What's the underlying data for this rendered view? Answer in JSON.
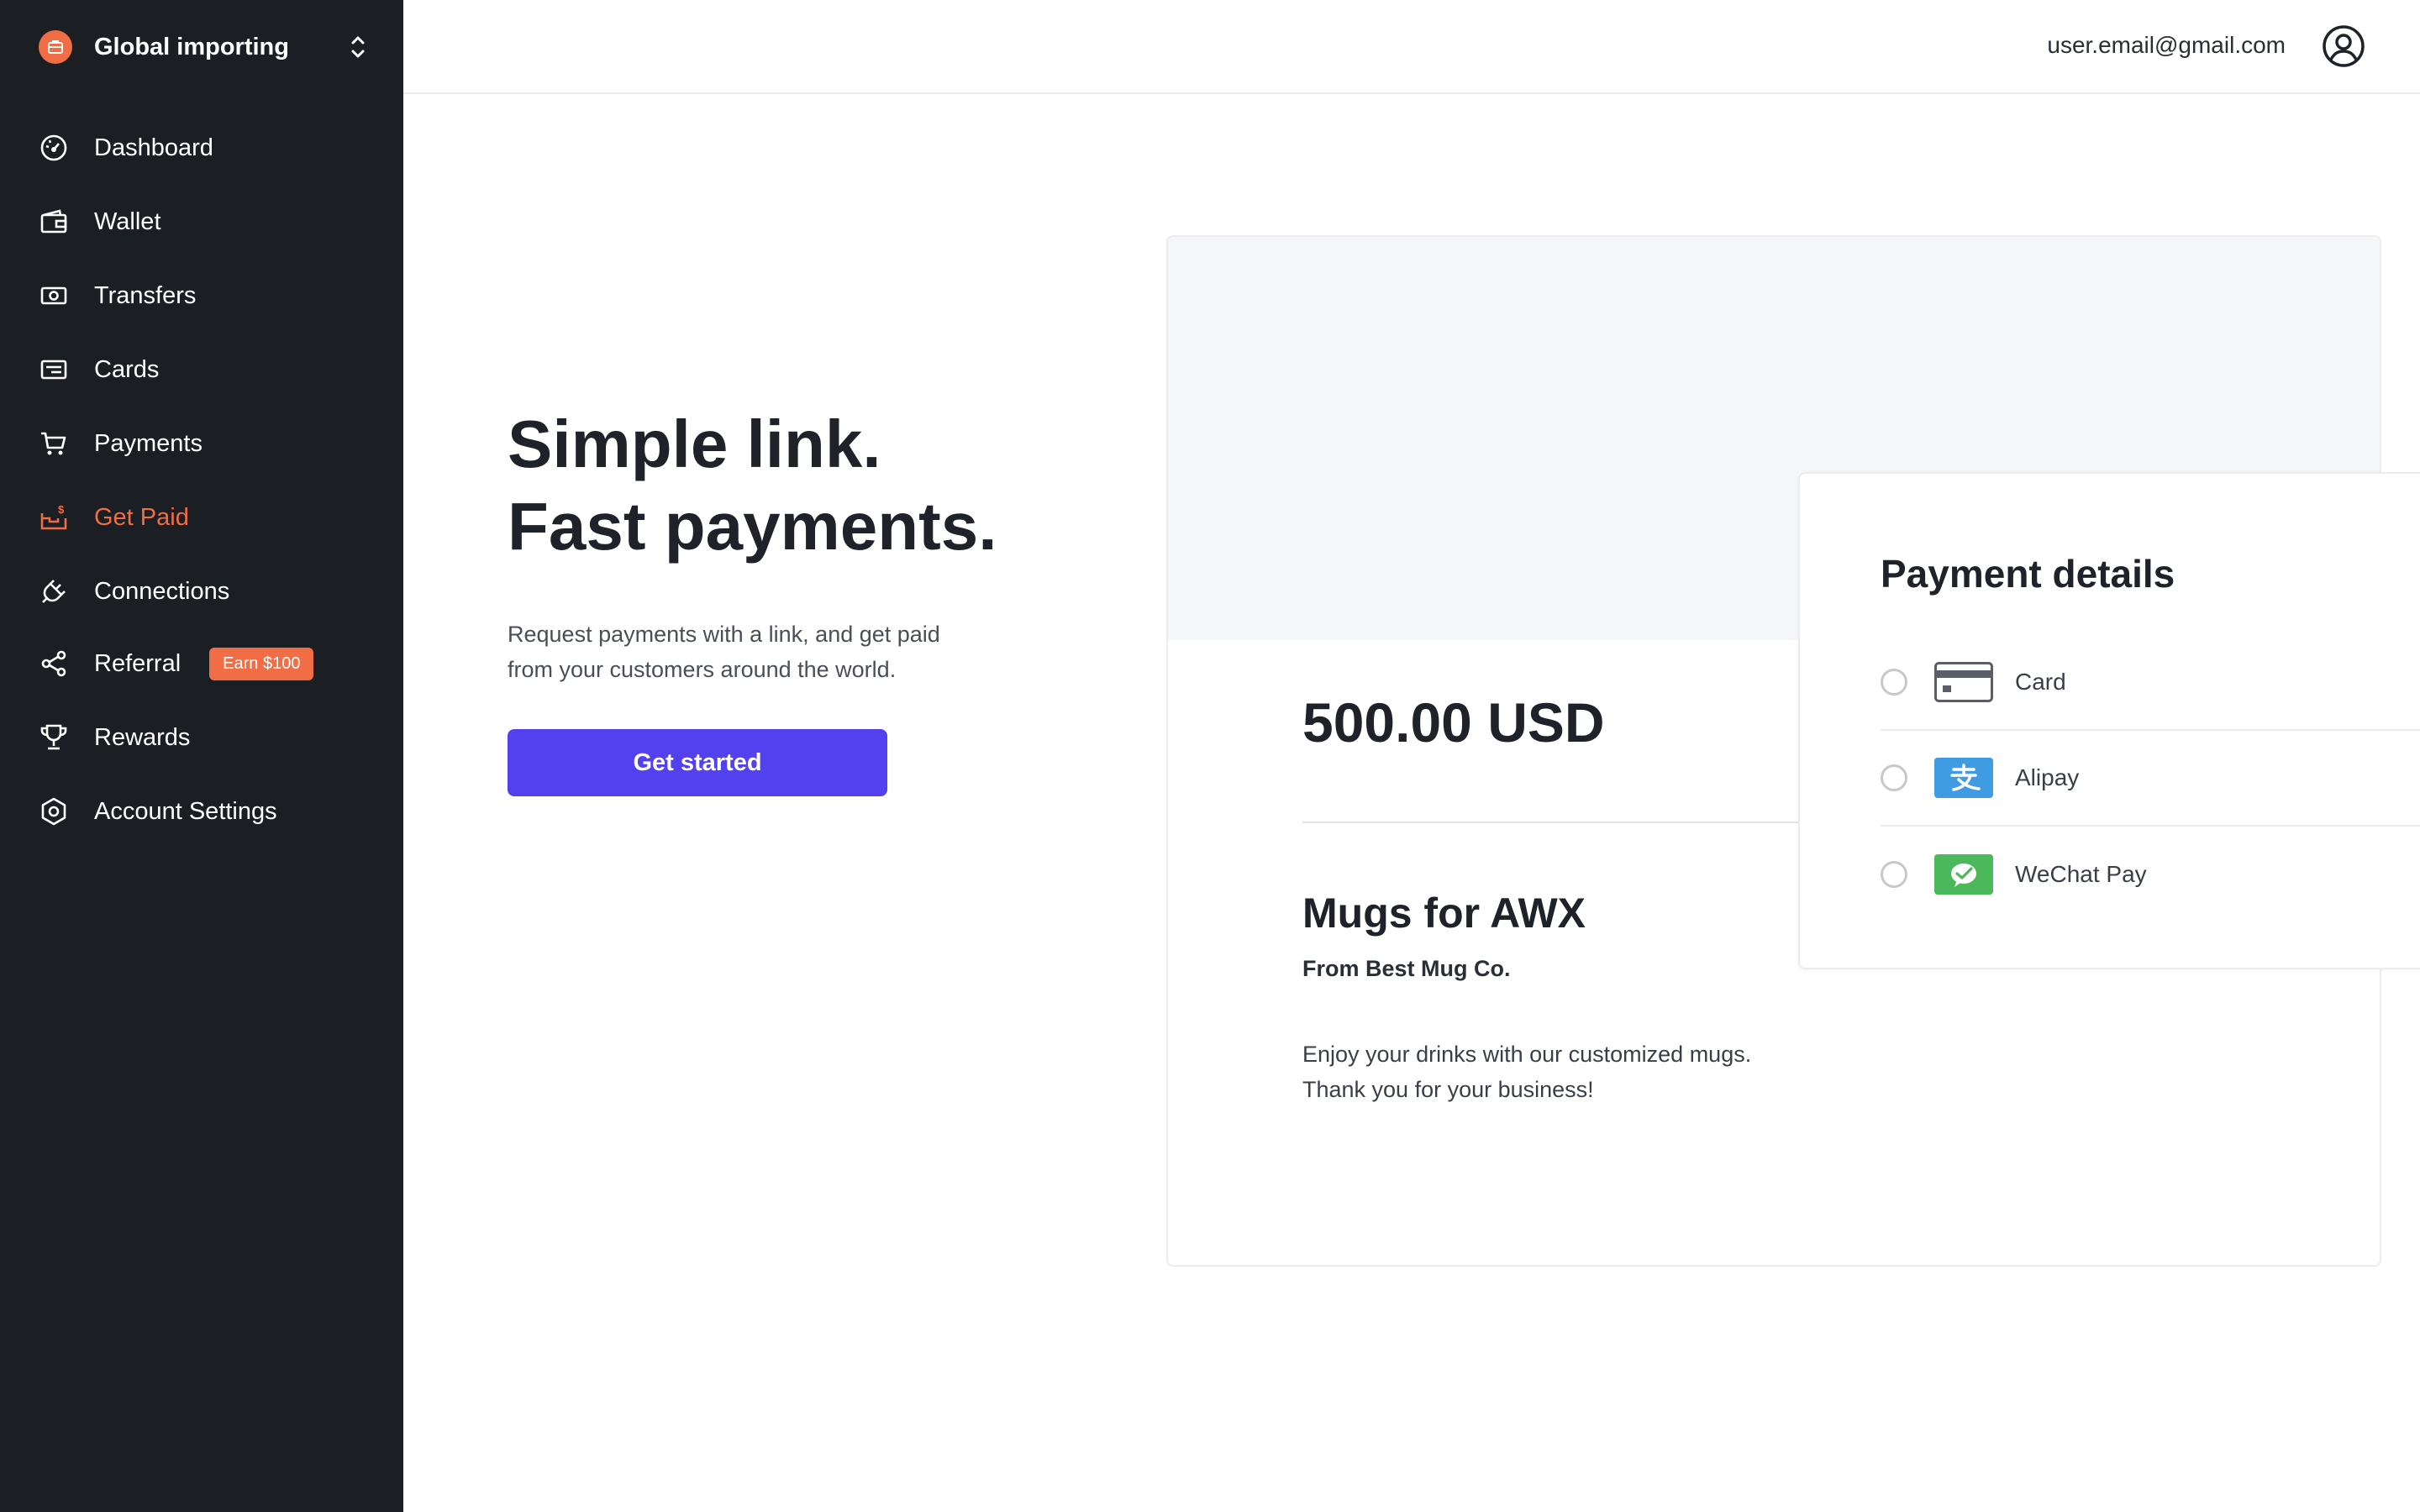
{
  "workspace": {
    "name": "Global importing",
    "logo_icon": "briefcase-icon",
    "switch_icon": "chevron-updown-icon"
  },
  "sidebar": {
    "items": [
      {
        "label": "Dashboard",
        "icon": "dashboard-icon",
        "active": false
      },
      {
        "label": "Wallet",
        "icon": "wallet-icon",
        "active": false
      },
      {
        "label": "Transfers",
        "icon": "transfers-icon",
        "active": false
      },
      {
        "label": "Cards",
        "icon": "card-icon",
        "active": false
      },
      {
        "label": "Payments",
        "icon": "cart-icon",
        "active": false
      },
      {
        "label": "Get Paid",
        "icon": "get-paid-icon",
        "active": true
      },
      {
        "label": "Connections",
        "icon": "plug-icon",
        "active": false
      },
      {
        "label": "Referral",
        "icon": "share-icon",
        "active": false,
        "badge": "Earn $100"
      },
      {
        "label": "Rewards",
        "icon": "trophy-icon",
        "active": false
      },
      {
        "label": "Account Settings",
        "icon": "gear-icon",
        "active": false
      }
    ]
  },
  "header": {
    "user_email": "user.email@gmail.com",
    "avatar_icon": "user-circle-icon"
  },
  "hero": {
    "title_line1": "Simple link.",
    "title_line2": "Fast payments.",
    "description": "Request payments with a link, and get paid from your customers around the world.",
    "cta_label": "Get started"
  },
  "preview": {
    "amount": "500.00 USD",
    "product_title": "Mugs for AWX",
    "merchant": "From Best Mug Co.",
    "description_line1": "Enjoy your drinks with our customized mugs.",
    "description_line2": "Thank you for your business!"
  },
  "payment_details": {
    "title": "Payment details",
    "methods": [
      {
        "label": "Card",
        "icon": "credit-card-icon"
      },
      {
        "label": "Alipay",
        "icon": "alipay-icon"
      },
      {
        "label": "WeChat Pay",
        "icon": "wechat-pay-icon"
      }
    ]
  },
  "colors": {
    "sidebar_bg": "#1b1e22",
    "accent_orange": "#f06d45",
    "primary_button": "#5340ef",
    "alipay_blue": "#3f9be2",
    "wechat_green": "#4cb85c"
  }
}
